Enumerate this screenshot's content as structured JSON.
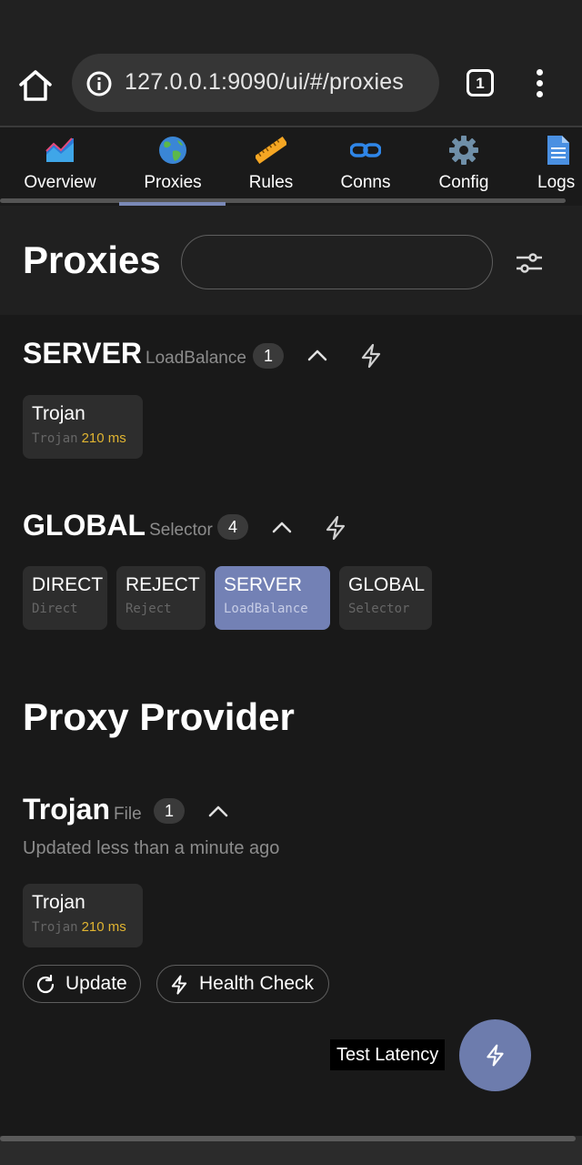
{
  "browser": {
    "url": "127.0.0.1:9090/ui/#/proxies",
    "tab_count": "1"
  },
  "nav": {
    "items": [
      {
        "label": "Overview",
        "icon": "chart-area-icon"
      },
      {
        "label": "Proxies",
        "icon": "globe-icon"
      },
      {
        "label": "Rules",
        "icon": "ruler-icon"
      },
      {
        "label": "Conns",
        "icon": "link-icon"
      },
      {
        "label": "Config",
        "icon": "gear-icon"
      },
      {
        "label": "Logs",
        "icon": "document-icon"
      }
    ],
    "active": "Proxies"
  },
  "header": {
    "title": "Proxies",
    "search_value": "",
    "search_placeholder": ""
  },
  "groups": [
    {
      "name": "SERVER",
      "type": "LoadBalance",
      "count": "1",
      "proxies": [
        {
          "name": "Trojan",
          "type": "Trojan",
          "latency": "210 ms"
        }
      ]
    },
    {
      "name": "GLOBAL",
      "type": "Selector",
      "count": "4",
      "proxies": [
        {
          "name": "DIRECT",
          "type": "Direct"
        },
        {
          "name": "REJECT",
          "type": "Reject"
        },
        {
          "name": "SERVER",
          "type": "LoadBalance",
          "selected": true
        },
        {
          "name": "GLOBAL",
          "type": "Selector"
        }
      ]
    }
  ],
  "provider_section": {
    "title": "Proxy Provider",
    "providers": [
      {
        "name": "Trojan",
        "type": "File",
        "count": "1",
        "updated": "Updated less than a minute ago",
        "proxies": [
          {
            "name": "Trojan",
            "type": "Trojan",
            "latency": "210 ms"
          }
        ],
        "update_label": "Update",
        "health_check_label": "Health Check"
      }
    ]
  },
  "fab": {
    "tooltip": "Test Latency"
  },
  "colors": {
    "accent": "#7381b5",
    "latency": "#e0b431",
    "background": "#191919"
  }
}
